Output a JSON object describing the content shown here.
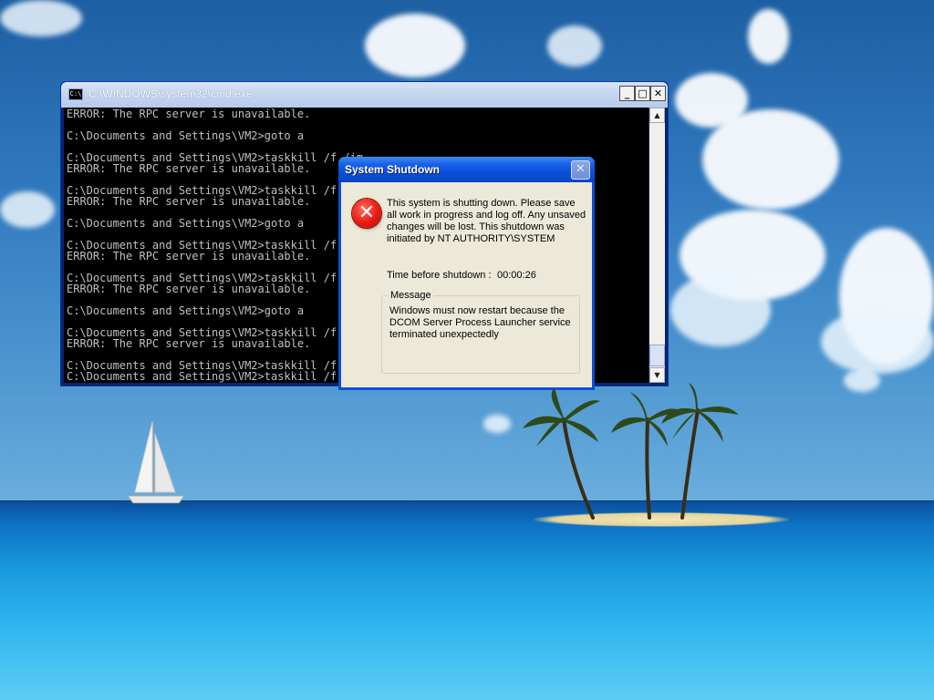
{
  "cmd_window": {
    "title": "C:\\WINDOWS\\system32\\cmd.exe",
    "lines": "ERROR: The RPC server is unavailable.\n\nC:\\Documents and Settings\\VM2>goto a\n\nC:\\Documents and Settings\\VM2>taskkill /f /im ...\nERROR: The RPC server is unavailable.\n\nC:\\Documents and Settings\\VM2>taskkill /f /im ...\nERROR: The RPC server is unavailable.\n\nC:\\Documents and Settings\\VM2>goto a\n\nC:\\Documents and Settings\\VM2>taskkill /f /im ...\nERROR: The RPC server is unavailable.\n\nC:\\Documents and Settings\\VM2>taskkill /f /im ...\nERROR: The RPC server is unavailable.\n\nC:\\Documents and Settings\\VM2>goto a\n\nC:\\Documents and Settings\\VM2>taskkill /f /im ...\nERROR: The RPC server is unavailable.\n\nC:\\Documents and Settings\\VM2>taskkill /f /im ...\nC:\\Documents and Settings\\VM2>taskkill /f /im ...",
    "icon": "cmd-icon"
  },
  "dialog": {
    "title": "System Shutdown",
    "close_glyph": "✕",
    "icon": "error-icon",
    "error_glyph": "✕",
    "body": "This system is shutting down. Please save all work in progress and log off. Any unsaved changes will be lost. This shutdown was initiated by NT AUTHORITY\\SYSTEM",
    "time_label": "Time before shutdown :",
    "time_value": "00:00:26",
    "message_legend": "Message",
    "message_text": "Windows must now restart because the DCOM Server Process Launcher service terminated unexpectedly"
  },
  "colors": {
    "dialog_title": "#0b4fd7",
    "dialog_face": "#ece9d8",
    "console_bg": "#000000",
    "console_text": "#c0c0c0"
  }
}
